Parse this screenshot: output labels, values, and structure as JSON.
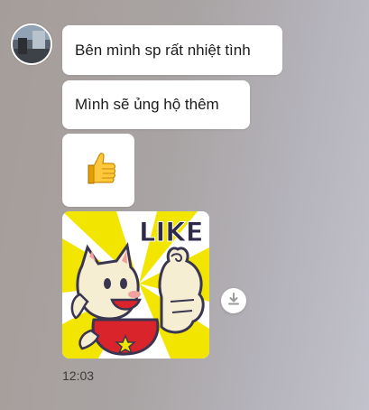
{
  "conversation": {
    "messages": [
      {
        "type": "text",
        "text": "Bên mình sp rất nhiệt tình"
      },
      {
        "type": "text",
        "text": "Mình sẽ ủng hộ thêm"
      },
      {
        "type": "emoji",
        "icon": "thumbs-up-icon",
        "text": "👍"
      },
      {
        "type": "sticker",
        "icon": "like-sticker",
        "text": "LIKE"
      }
    ],
    "timestamp": "12:03"
  },
  "colors": {
    "bubble": "#ffffff",
    "sticker_yellow": "#f2e600",
    "download_icon": "#9a9a9a"
  }
}
